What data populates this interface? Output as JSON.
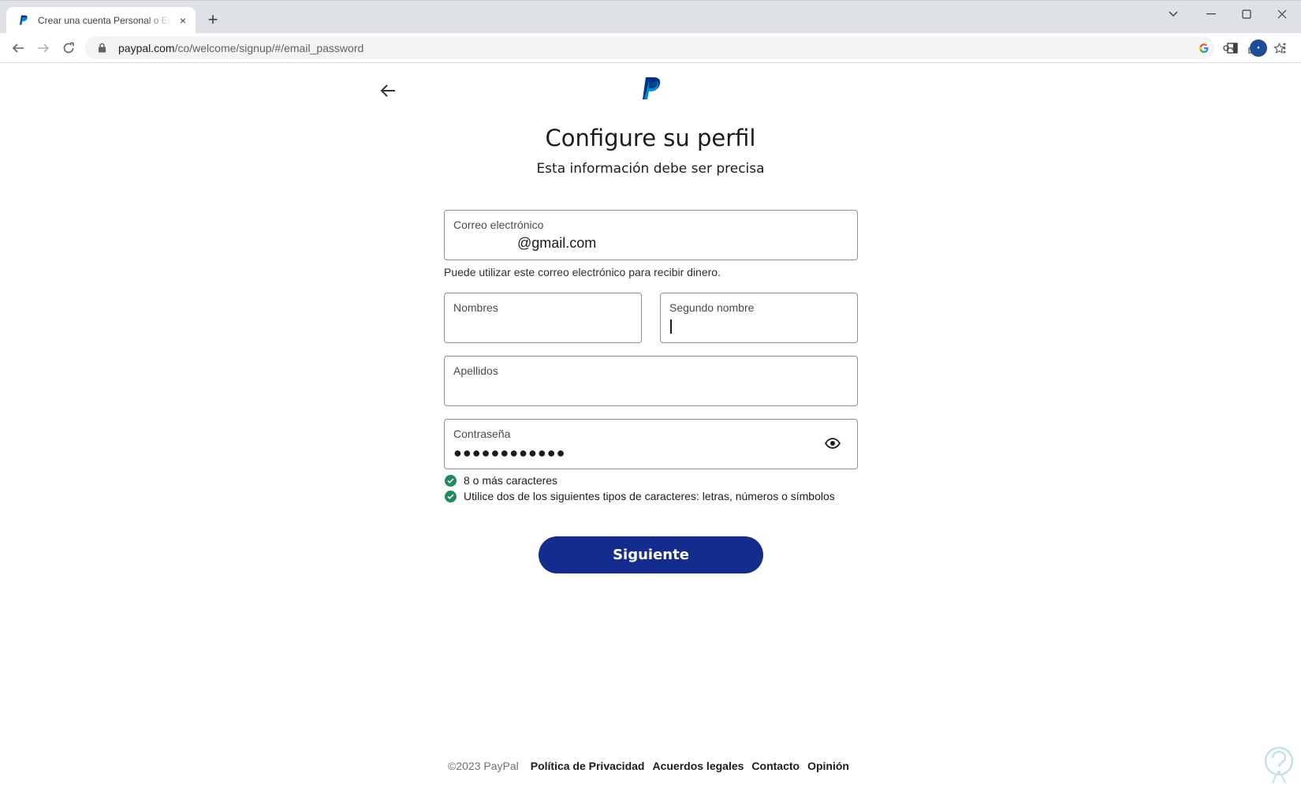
{
  "browser": {
    "tab_title": "Crear una cuenta Personal o Empresa",
    "url_host": "paypal.com",
    "url_path": "/co/welcome/signup/#/email_password",
    "new_tab": "+",
    "tab_close": "×"
  },
  "page": {
    "heading": "Configure su perfil",
    "subheading": "Esta información debe ser precisa",
    "email": {
      "label": "Correo electrónico",
      "value": "@gmail.com",
      "helper": "Puede utilizar este correo electrónico para recibir dinero."
    },
    "first_name": {
      "label": "Nombres",
      "value": ""
    },
    "middle_name": {
      "label": "Segundo nombre",
      "value": ""
    },
    "last_name": {
      "label": "Apellidos",
      "value": ""
    },
    "password": {
      "label": "Contraseña",
      "value": "●●●●●●●●●●●●"
    },
    "requirements": [
      {
        "text": "8 o más caracteres",
        "met": true
      },
      {
        "text": "Utilice dos de los siguientes tipos de caracteres: letras, números o símbolos",
        "met": true
      }
    ],
    "next_button": "Siguiente"
  },
  "footer": {
    "copyright": "©2023 PayPal",
    "links": [
      "Política de Privacidad",
      "Acuerdos legales",
      "Contacto",
      "Opinión"
    ]
  },
  "colors": {
    "primary_button": "#142c8e",
    "check_green": "#1f8a5b",
    "paypal_dark": "#003087",
    "paypal_light": "#009cde"
  },
  "icons": {
    "back": "arrow-left-icon",
    "visibility": "eye-icon",
    "check": "check-circle-icon"
  }
}
